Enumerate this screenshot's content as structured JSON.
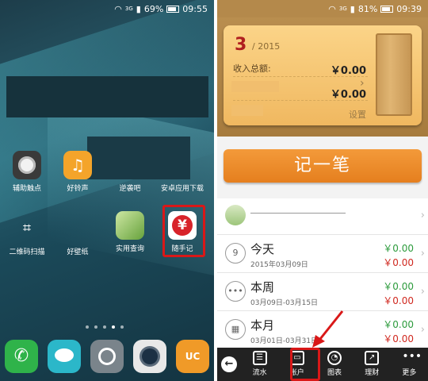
{
  "left_phone": {
    "status": {
      "signal": "3G",
      "battery": "69%",
      "time": "09:55"
    },
    "apps_row1": [
      {
        "label": "辅助触点",
        "icon": "touch-assist-icon"
      },
      {
        "label": "好铃声",
        "icon": "music-note-icon"
      },
      {
        "label": "逆袭吧",
        "icon": "game-icon"
      },
      {
        "label": "安卓应用下载",
        "icon": "store-icon"
      }
    ],
    "apps_row2": [
      {
        "label": "二维码扫描",
        "icon": "qr-scan-icon"
      },
      {
        "label": "好壁纸",
        "icon": "wallpaper-icon"
      },
      {
        "label": "实用查询",
        "icon": "search-map-icon"
      },
      {
        "label": "随手记",
        "icon": "yen-icon",
        "glyph": "¥"
      }
    ],
    "dock": [
      "phone-icon",
      "message-icon",
      "settings-icon",
      "camera-icon",
      "uc-browser-icon"
    ],
    "highlight_color": "#d91818"
  },
  "right_phone": {
    "status": {
      "signal": "3G",
      "battery": "81%",
      "time": "09:39"
    },
    "card": {
      "month": "3",
      "year": "/ 2015",
      "income_label": "收入总额:",
      "income_value": "￥0.00",
      "expense_value": "￥0.00",
      "budget_link": "设置"
    },
    "record_button": "记一笔",
    "periods": [
      {
        "icon_text": "9",
        "title": "今天",
        "range": "2015年03月09日",
        "income": "￥0.00",
        "expense": "￥0.00"
      },
      {
        "icon_text": "•••",
        "title": "本周",
        "range": "03月09日-03月15日",
        "income": "￥0.00",
        "expense": "￥0.00"
      },
      {
        "icon_text": "▦",
        "title": "本月",
        "range": "03月01日-03月31日",
        "income": "￥0.00",
        "expense": "￥0.00"
      }
    ],
    "bottom_nav": [
      {
        "label": "流水",
        "glyph": "☰"
      },
      {
        "label": "账户",
        "glyph": "▭"
      },
      {
        "label": "图表",
        "glyph": "◔"
      },
      {
        "label": "理财",
        "glyph": "↗"
      },
      {
        "label": "更多",
        "glyph": "•••"
      }
    ],
    "colors": {
      "income": "#2c9b3c",
      "expense": "#d0281f",
      "accent": "#e57f1e"
    }
  }
}
